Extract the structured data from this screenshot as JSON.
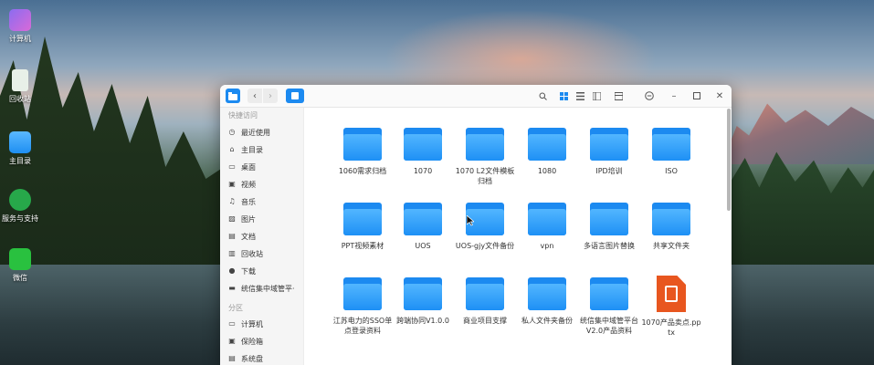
{
  "desktop": {
    "icons": [
      {
        "label": "计算机",
        "icon": "computer-icon"
      },
      {
        "label": "回收站",
        "icon": "trash-icon"
      },
      {
        "label": "主目录",
        "icon": "home-folder-icon"
      },
      {
        "label": "服务与支持",
        "icon": "support-icon"
      },
      {
        "label": "微信",
        "icon": "wechat-icon"
      }
    ]
  },
  "window": {
    "app_icon": "file-manager-icon",
    "toolbar_icons": [
      "back-icon",
      "forward-icon",
      "location-icon",
      "search-icon",
      "icon-view-icon",
      "list-view-icon",
      "detail-view-icon",
      "sort-icon",
      "menu-icon",
      "minimize-icon",
      "maximize-icon",
      "close-icon"
    ]
  },
  "sidebar": {
    "quick_access_label": "快捷访问",
    "quick_access": [
      {
        "label": "最近使用",
        "icon": "recent-icon"
      },
      {
        "label": "主目录",
        "icon": "home-icon"
      },
      {
        "label": "桌面",
        "icon": "desktop-icon"
      },
      {
        "label": "视频",
        "icon": "video-icon"
      },
      {
        "label": "音乐",
        "icon": "music-icon"
      },
      {
        "label": "图片",
        "icon": "picture-icon"
      },
      {
        "label": "文档",
        "icon": "document-icon"
      },
      {
        "label": "回收站",
        "icon": "trash-icon"
      },
      {
        "label": "下载",
        "icon": "download-icon"
      },
      {
        "label": "统信集中域管平·",
        "icon": "folder-icon"
      }
    ],
    "partition_label": "分区",
    "partitions": [
      {
        "label": "计算机",
        "icon": "computer-icon"
      },
      {
        "label": "保险箱",
        "icon": "safe-icon"
      },
      {
        "label": "系统盘",
        "icon": "disk-icon"
      }
    ]
  },
  "files": [
    {
      "name": "1060需求归档",
      "type": "folder"
    },
    {
      "name": "1070",
      "type": "folder"
    },
    {
      "name": "1070 L2文件模板归档",
      "type": "folder"
    },
    {
      "name": "1080",
      "type": "folder"
    },
    {
      "name": "IPD培训",
      "type": "folder"
    },
    {
      "name": "ISO",
      "type": "folder"
    },
    {
      "name": "PPT视频素材",
      "type": "folder"
    },
    {
      "name": "UOS",
      "type": "folder"
    },
    {
      "name": "UOS-gjy文件备份",
      "type": "folder"
    },
    {
      "name": "vpn",
      "type": "folder"
    },
    {
      "name": "多语言图片替换",
      "type": "folder"
    },
    {
      "name": "共享文件夹",
      "type": "folder"
    },
    {
      "name": "江苏电力的SSO单点登录资料",
      "type": "folder"
    },
    {
      "name": "跨端协同V1.0.0",
      "type": "folder"
    },
    {
      "name": "商业项目支撑",
      "type": "folder"
    },
    {
      "name": "私人文件夹备份",
      "type": "folder"
    },
    {
      "name": "统信集中域管平台V2.0产品资料",
      "type": "folder"
    },
    {
      "name": "1070产品卖点.pptx",
      "type": "pptx"
    }
  ],
  "colors": {
    "accent": "#1c8af0",
    "pptx": "#e8561f"
  }
}
